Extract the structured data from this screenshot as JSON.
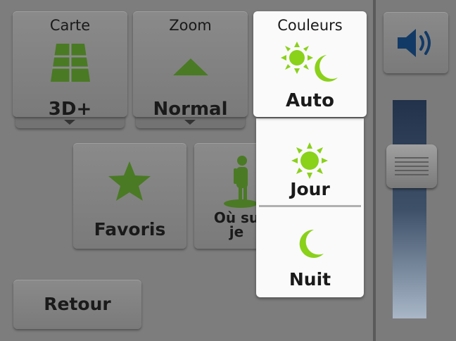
{
  "tiles": {
    "map": {
      "label": "Carte",
      "value": "3D+"
    },
    "zoom": {
      "label": "Zoom",
      "value": "Normal"
    },
    "colors": {
      "label": "Couleurs",
      "value": "Auto"
    }
  },
  "buttons": {
    "favorites": "Favoris",
    "where_am_i_line1": "Où su",
    "where_am_i_line2": "je",
    "back": "Retour"
  },
  "color_menu": {
    "options": [
      {
        "label": "Jour",
        "icon": "sun-icon"
      },
      {
        "label": "Nuit",
        "icon": "moon-icon"
      }
    ]
  },
  "volume": {
    "icon": "speaker-icon",
    "level": 0.72
  },
  "colors": {
    "accent": "#8ad11a",
    "dark_green": "#3f6b1e",
    "panel": "#7d7d7d",
    "popup": "#fafafa"
  }
}
